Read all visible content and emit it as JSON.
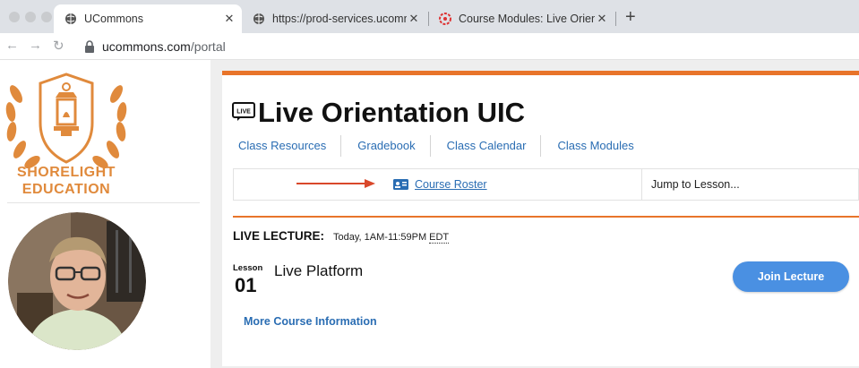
{
  "browser": {
    "tabs": [
      {
        "title": "UCommons",
        "active": true
      },
      {
        "title": "https://prod-services.ucommo",
        "active": false
      },
      {
        "title": "Course Modules: Live Orientati",
        "active": false
      }
    ],
    "close_glyph": "✕",
    "new_tab_glyph": "+",
    "url_host": "ucommons.com",
    "url_path": "/portal"
  },
  "sidebar": {
    "brand_line1": "SHORELIGHT",
    "brand_line2": "EDUCATION",
    "brand_color": "#e08a3c"
  },
  "course": {
    "live_badge": "LIVE",
    "title": "Live Orientation UIC",
    "nav": [
      "Class Resources",
      "Gradebook",
      "Class Calendar",
      "Class Modules"
    ],
    "roster_link": "Course Roster",
    "jump_placeholder": "Jump to Lesson...",
    "accent_color": "#e8742a",
    "link_color": "#2a6db3"
  },
  "lecture": {
    "label": "LIVE LECTURE:",
    "time": "Today, 1AM-11:59PM",
    "timezone": "EDT",
    "lesson_word": "Lesson",
    "lesson_number": "01",
    "lesson_name": "Live Platform",
    "join_label": "Join Lecture",
    "more_info": "More Course Information"
  }
}
